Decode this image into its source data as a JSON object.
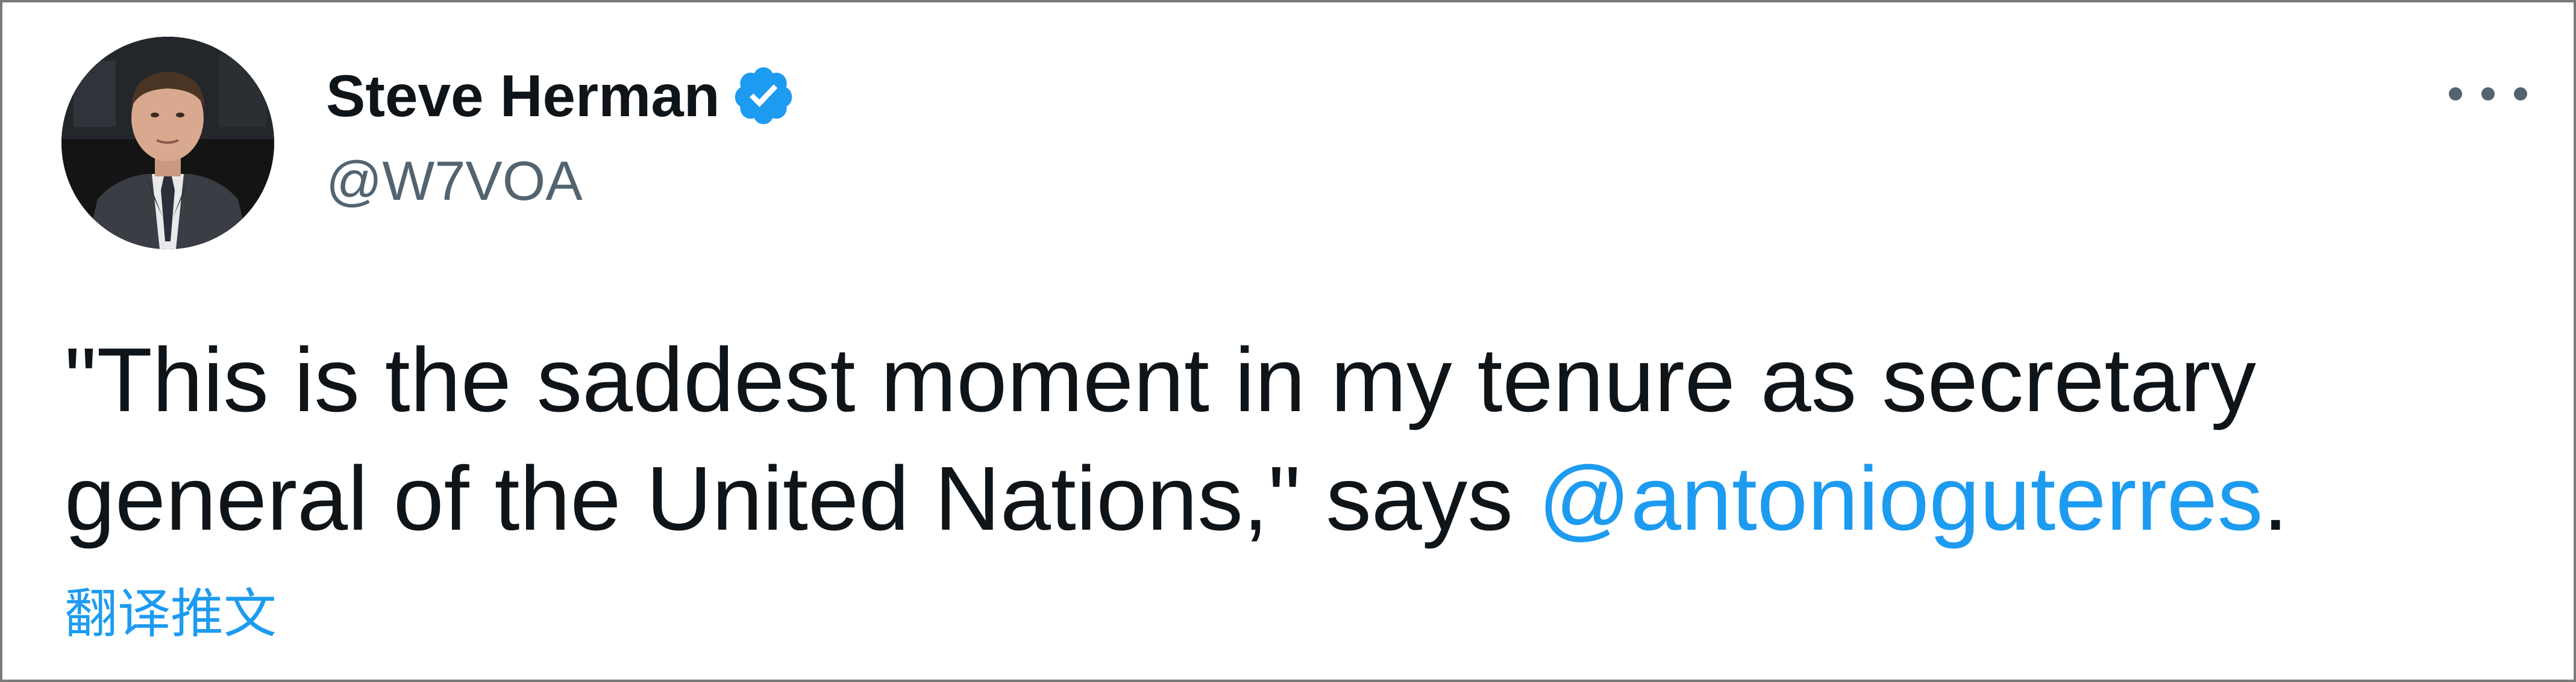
{
  "tweet": {
    "author": {
      "display_name": "Steve Herman",
      "handle": "@W7VOA",
      "verified": true,
      "avatar_icon": "profile-photo"
    },
    "text_line1": "\"This is the saddest moment in my tenure as secretary",
    "text_line2_prefix": "general of the United Nations,\" says ",
    "mention": "@antonioguterres",
    "text_line2_suffix": ".",
    "translate_label": "翻译推文",
    "more_icon": "ellipsis-icon"
  },
  "colors": {
    "text": "#0f1419",
    "secondary": "#536471",
    "link": "#1d9bf0",
    "verified_badge": "#1d9bf0",
    "border": "#7a7a7a"
  }
}
